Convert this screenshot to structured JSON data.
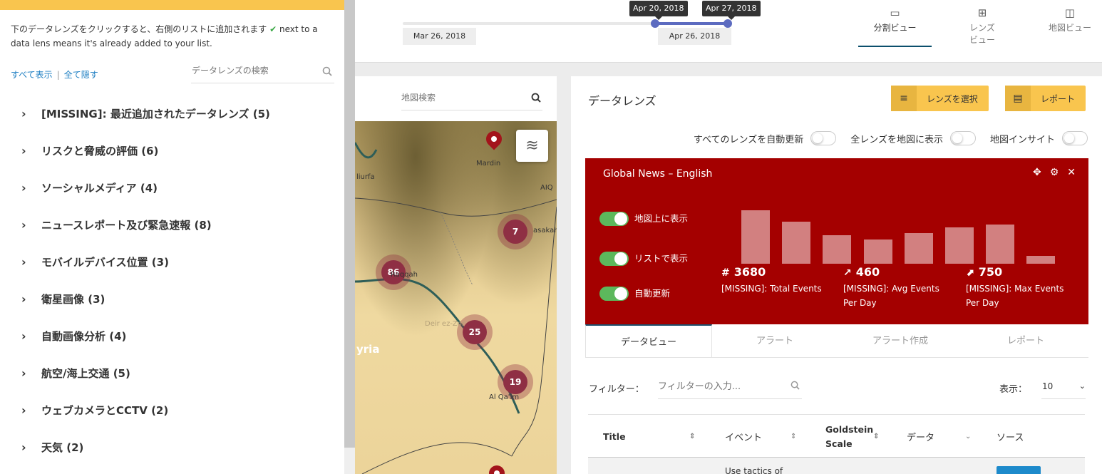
{
  "timeline": {
    "start_date": "Mar 26, 2018",
    "end_date": "Apr 26, 2018",
    "handle_left_label": "Apr 20, 2018",
    "handle_right_label": "Apr 27, 2018"
  },
  "views": [
    {
      "label": "分割ビュー",
      "icon": "split-view-icon",
      "active": true
    },
    {
      "label": "レンズ\nビュー",
      "icon": "grid-view-icon",
      "active": false
    },
    {
      "label": "地図ビュー",
      "icon": "map-view-icon",
      "active": false
    }
  ],
  "left_panel": {
    "intro_text": "下のデータレンズをクリックすると、右側のリストに追加されます",
    "intro_text_en": "next to a data lens means it's already added to your list.",
    "show_all": "すべて表示",
    "hide_all": "全て隠す",
    "search_placeholder": "データレンズの検索",
    "categories": [
      "[MISSING]: 最近追加されたデータレンズ (5)",
      "リスクと脅威の評価 (6)",
      "ソーシャルメディア (4)",
      "ニュースレポート及び緊急速報 (8)",
      "モバイルデバイス位置 (3)",
      "衛星画像 (3)",
      "自動画像分析 (4)",
      "航空/海上交通 (5)",
      "ウェブカメラとCCTV (2)",
      "天気 (2)"
    ]
  },
  "map": {
    "search_placeholder": "地図検索",
    "clusters": [
      "7",
      "86",
      "25",
      "19"
    ],
    "places": {
      "mardin": "Mardin",
      "sanliurfa": "liurfa",
      "aiq": "AIQ",
      "raqqah": "Raqqah",
      "deir": "Deir ez-Zor",
      "syria": "yria",
      "qaim": "Al Qa'im",
      "hasakah": "asakah"
    }
  },
  "lens_panel": {
    "title": "データレンズ",
    "select_lens": "レンズを選択",
    "report": "レポート",
    "auto_update_all": "すべてのレンズを自動更新",
    "show_all_on_map": "全レンズを地図に表示",
    "map_insight": "地図インサイト",
    "lens": {
      "title": "Global News – English",
      "toggles": [
        {
          "label": "地図上に表示",
          "on": true
        },
        {
          "label": "リストで表示",
          "on": true
        },
        {
          "label": "自動更新",
          "on": true
        }
      ],
      "bars": [
        75,
        59,
        40,
        34,
        43,
        51,
        55,
        11
      ],
      "stats": [
        {
          "icon": "hash-icon",
          "value": "3680",
          "label": "[MISSING]: Total Events"
        },
        {
          "icon": "trend-icon",
          "value": "460",
          "label": "[MISSING]: Avg Events Per Day"
        },
        {
          "icon": "chart-up-icon",
          "value": "750",
          "label": "[MISSING]: Max Events Per Day"
        }
      ]
    },
    "tabs": [
      "データビュー",
      "アラート",
      "アラート作成",
      "レポート"
    ],
    "filter_label": "フィルター：",
    "filter_placeholder": "フィルターの入力...",
    "show_label": "表示：",
    "show_value": "10",
    "columns": [
      "Title",
      "イベント",
      "Goldstein Scale",
      "データ",
      "ソース"
    ],
    "first_row_event": "Use tactics of"
  }
}
